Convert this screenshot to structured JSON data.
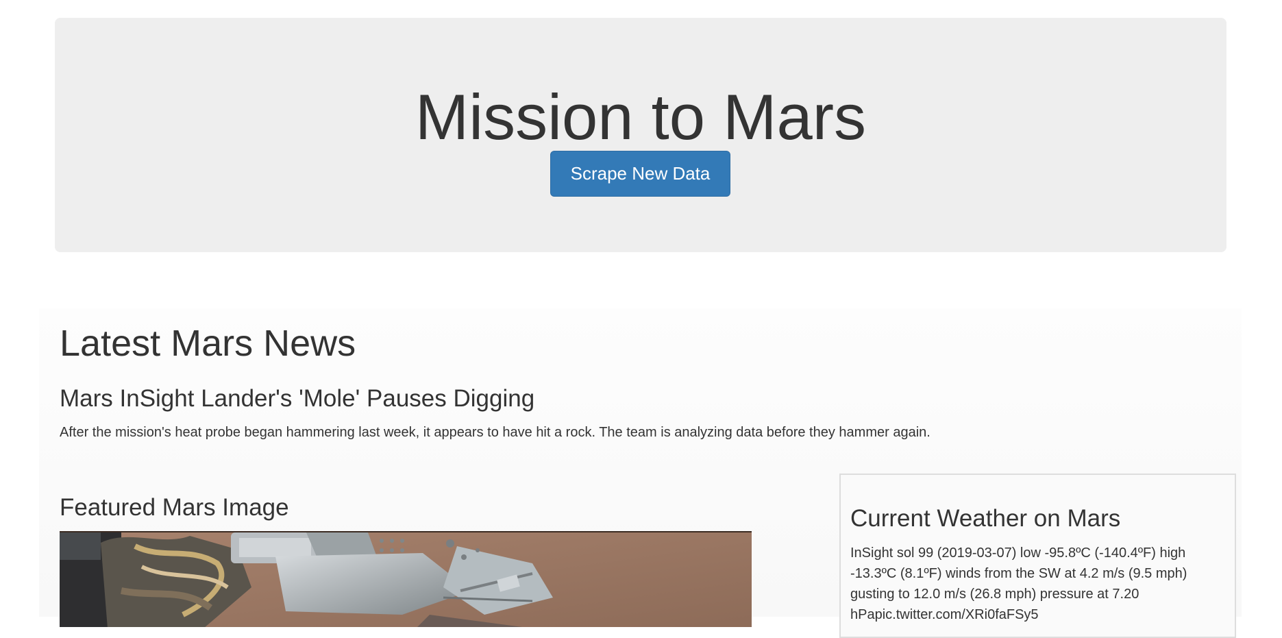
{
  "header": {
    "title": "Mission to Mars",
    "scrape_button_label": "Scrape New Data"
  },
  "news": {
    "section_heading": "Latest Mars News",
    "article_title": "Mars InSight Lander's 'Mole' Pauses Digging",
    "article_paragraph": "After the mission's heat probe began hammering last week, it appears to have hit a rock. The team is analyzing data before they hammer again."
  },
  "featured_image": {
    "section_heading": "Featured Mars Image",
    "image_icon": "mars-rover-photo"
  },
  "weather": {
    "section_heading": "Current Weather on Mars",
    "report": "InSight sol 99 (2019-03-07) low -95.8ºC (-140.4ºF) high -13.3ºC (8.1ºF) winds from the SW at 4.2 m/s (9.5 mph) gusting to 12.0 m/s (26.8 mph) pressure at 7.20 hPapic.twitter.com/XRi0faFSy5"
  },
  "colors": {
    "primary_button": "#337ab7",
    "jumbotron_bg": "#eeeeee",
    "text": "#333333"
  }
}
